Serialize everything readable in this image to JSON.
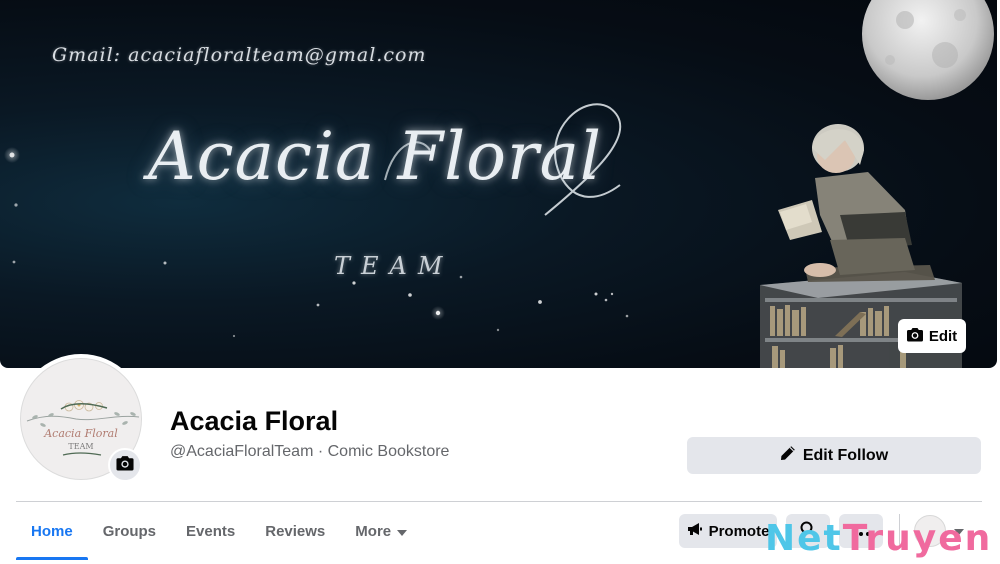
{
  "cover": {
    "email_text": "Gmail: acaciafloralteam@gmal.com",
    "title_text": "Acacia Floral",
    "subtitle_text": "TEAM",
    "edit_label": "Edit",
    "edit_icon": "camera-icon"
  },
  "avatar": {
    "logo_line1": "Acacia Floral",
    "logo_line2": "TEAM",
    "camera_icon": "camera-icon"
  },
  "profile": {
    "name": "Acacia Floral",
    "meta": "@AcaciaFloralTeam · Comic Bookstore"
  },
  "edit_follow": {
    "label": "Edit Follow",
    "icon": "pencil-icon"
  },
  "tabs": [
    {
      "label": "Home",
      "active": true
    },
    {
      "label": "Groups",
      "active": false
    },
    {
      "label": "Events",
      "active": false
    },
    {
      "label": "Reviews",
      "active": false
    },
    {
      "label": "More",
      "active": false,
      "icon": "caret-down-icon"
    }
  ],
  "actions": {
    "promote_label": "Promote",
    "promote_icon": "megaphone-icon",
    "search_icon": "search-icon",
    "more_icon": "ellipsis-icon",
    "switch_icon": "caret-down-icon"
  },
  "watermark": {
    "part1": "Net",
    "part2": "Truyen"
  },
  "colors": {
    "accent": "#1877f2",
    "button_bg": "#e4e6eb",
    "secondary_text": "#65676b",
    "cover_bg": "#060d15"
  }
}
